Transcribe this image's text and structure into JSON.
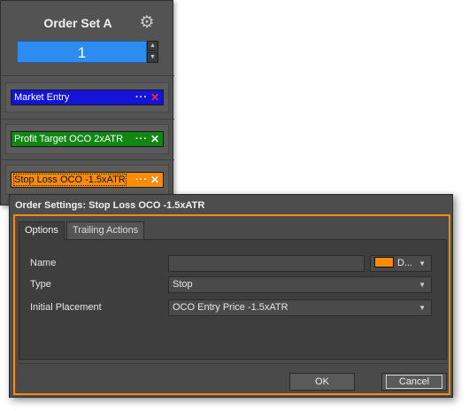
{
  "order_set": {
    "title": "Order Set A",
    "icon": "gear-icon",
    "quantity": "1",
    "orders": [
      {
        "label": "Market Entry",
        "dots": "···",
        "close": "✕",
        "color": "#1414d8"
      },
      {
        "label": "Profit Target OCO  2xATR",
        "dots": "···",
        "close": "✕",
        "color": "#128612"
      },
      {
        "label": "Stop Loss OCO  -1.5xATR",
        "dots": "···",
        "close": "✕",
        "color": "#ff8c00"
      }
    ]
  },
  "dialog": {
    "title": "Order Settings: Stop Loss OCO  -1.5xATR",
    "tabs": [
      "Options",
      "Trailing Actions"
    ],
    "fields": {
      "name_label": "Name",
      "name_value": "",
      "color_value": "D...",
      "type_label": "Type",
      "type_value": "Stop",
      "placement_label": "Initial Placement",
      "placement_value": "OCO Entry Price -1.5xATR"
    },
    "ok_label": "OK",
    "cancel_label": "Cancel",
    "accent": "#ff8c00"
  }
}
